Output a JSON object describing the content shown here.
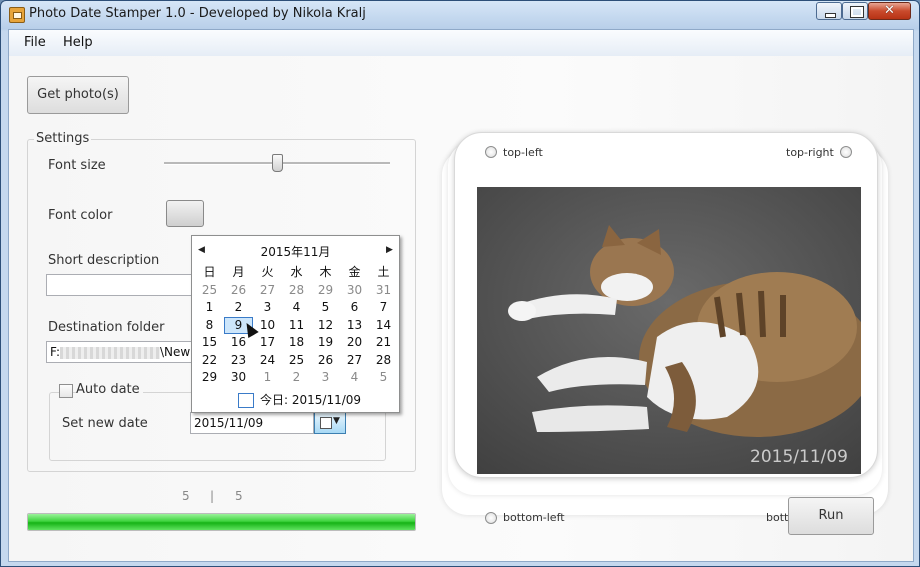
{
  "window": {
    "title": "Photo Date Stamper 1.0 - Developed by Nikola Kralj",
    "close_glyph": "✕"
  },
  "menu": {
    "file": "File",
    "help": "Help"
  },
  "buttons": {
    "get_photos": "Get photo(s)",
    "run": "Run"
  },
  "settings": {
    "legend": "Settings",
    "font_size_label": "Font size",
    "font_size_level": 0.5,
    "font_color_label": "Font color",
    "short_description_label": "Short description",
    "short_description_value": "",
    "destination_folder_label": "Destination folder",
    "destination_prefix": "F:",
    "destination_suffix": "\\New",
    "auto_date_label": "Auto date",
    "auto_date_checked": false,
    "set_new_date_label": "Set new date",
    "date_value": "2015/11/09"
  },
  "calendar": {
    "prev": "◀",
    "next": "▶",
    "title": "2015年11月",
    "weekdays": [
      "日",
      "月",
      "火",
      "水",
      "木",
      "金",
      "土"
    ],
    "weeks": [
      [
        {
          "d": "25",
          "m": true
        },
        {
          "d": "26",
          "m": true
        },
        {
          "d": "27",
          "m": true
        },
        {
          "d": "28",
          "m": true
        },
        {
          "d": "29",
          "m": true
        },
        {
          "d": "30",
          "m": true
        },
        {
          "d": "31",
          "m": true
        }
      ],
      [
        {
          "d": "1"
        },
        {
          "d": "2"
        },
        {
          "d": "3"
        },
        {
          "d": "4"
        },
        {
          "d": "5"
        },
        {
          "d": "6"
        },
        {
          "d": "7"
        }
      ],
      [
        {
          "d": "8"
        },
        {
          "d": "9",
          "sel": true
        },
        {
          "d": "10"
        },
        {
          "d": "11"
        },
        {
          "d": "12"
        },
        {
          "d": "13"
        },
        {
          "d": "14"
        }
      ],
      [
        {
          "d": "15"
        },
        {
          "d": "16"
        },
        {
          "d": "17"
        },
        {
          "d": "18"
        },
        {
          "d": "19"
        },
        {
          "d": "20"
        },
        {
          "d": "21"
        }
      ],
      [
        {
          "d": "22"
        },
        {
          "d": "23"
        },
        {
          "d": "24"
        },
        {
          "d": "25"
        },
        {
          "d": "26"
        },
        {
          "d": "27"
        },
        {
          "d": "28"
        }
      ],
      [
        {
          "d": "29"
        },
        {
          "d": "30"
        },
        {
          "d": "1",
          "m": true
        },
        {
          "d": "2",
          "m": true
        },
        {
          "d": "3",
          "m": true
        },
        {
          "d": "4",
          "m": true
        },
        {
          "d": "5",
          "m": true
        }
      ]
    ],
    "today": "今日: 2015/11/09",
    "dropdown_arrow": "▼"
  },
  "progress": {
    "current": "5",
    "separator": "|",
    "total": "5",
    "fraction": 1.0
  },
  "preview": {
    "top_left": "top-left",
    "top_right": "top-right",
    "bottom_left": "bottom-left",
    "bottom_right": "bottom-right",
    "selected_position": "bottom-right",
    "stamp_text": "2015/11/09"
  }
}
